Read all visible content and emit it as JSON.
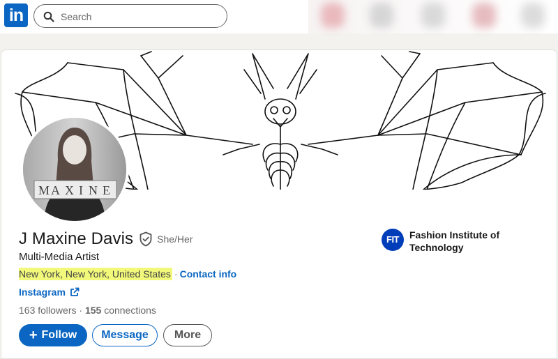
{
  "nav": {
    "logo_text": "in",
    "search_placeholder": "Search"
  },
  "profile": {
    "name": "J Maxine Davis",
    "pronouns": "She/Her",
    "headline": "Multi-Media Artist",
    "location": "New York, New York, United States",
    "separator": "·",
    "contact_label": "Contact info",
    "website_label": "Instagram",
    "followers_count": "163",
    "followers_label": " followers",
    "stats_separator": " · ",
    "connections_count": "155",
    "connections_label": " connections",
    "avatar_sign_letters": [
      "M",
      "A",
      "X",
      "I",
      "N",
      "E"
    ]
  },
  "education": {
    "logo_text": "FIT",
    "name": "Fashion Institute of Technology"
  },
  "actions": {
    "follow_label": "Follow",
    "follow_icon": "+",
    "message_label": "Message",
    "more_label": "More"
  },
  "colors": {
    "brand": "#0a66c2",
    "highlight": "#f2f97a",
    "school": "#003db8"
  }
}
